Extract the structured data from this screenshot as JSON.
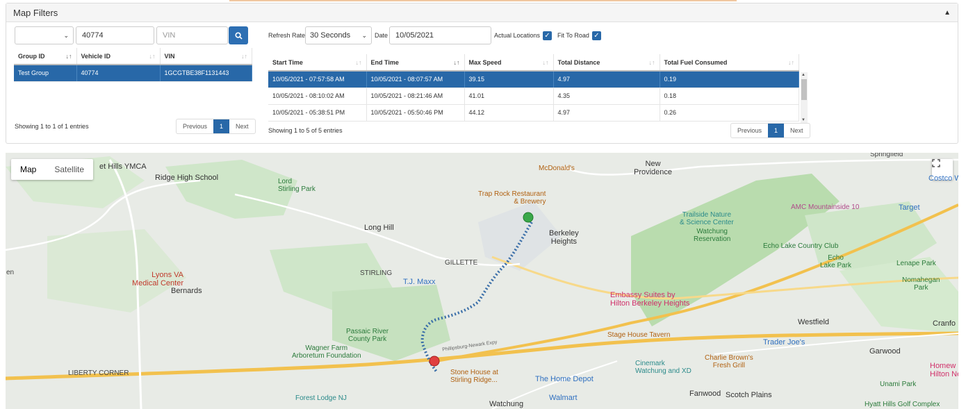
{
  "panel": {
    "title": "Map Filters"
  },
  "filters": {
    "group_select_value": "",
    "vehicle_id_value": "40774",
    "vin_placeholder": "VIN",
    "refresh_label": "Refresh Rate",
    "refresh_value": "30 Seconds",
    "date_label": "Date",
    "date_value": "10/05/2021",
    "actual_locations_label": "Actual Locations",
    "fit_to_road_label": "Fit To Road"
  },
  "vehicles_table": {
    "headers": [
      "Group ID",
      "Vehicle ID",
      "VIN"
    ],
    "rows": [
      [
        "Test Group",
        "40774",
        "1GCGTBE38F1131443"
      ]
    ],
    "showing": "Showing 1 to 1 of 1 entries",
    "pager": {
      "prev": "Previous",
      "page": "1",
      "next": "Next"
    }
  },
  "trips_table": {
    "headers": [
      "Start Time",
      "End Time",
      "Max Speed",
      "Total Distance",
      "Total Fuel Consumed"
    ],
    "rows": [
      [
        "10/05/2021 - 07:57:58 AM",
        "10/05/2021 - 08:07:57 AM",
        "39.15",
        "4.97",
        "0.19"
      ],
      [
        "10/05/2021 - 08:10:02 AM",
        "10/05/2021 - 08:21:46 AM",
        "41.01",
        "4.35",
        "0.18"
      ],
      [
        "10/05/2021 - 05:38:51 PM",
        "10/05/2021 - 05:50:46 PM",
        "44.12",
        "4.97",
        "0.26"
      ]
    ],
    "showing": "Showing 1 to 5 of 5 entries",
    "pager": {
      "prev": "Previous",
      "page": "1",
      "next": "Next"
    }
  },
  "map": {
    "type_map": "Map",
    "type_satellite": "Satellite",
    "labels": {
      "ymca": "et Hills YMCA",
      "ridge_high": "Ridge High School",
      "lord_stirling": "Lord\nStirling Park",
      "long_hill": "Long Hill",
      "stirling": "STIRLING",
      "gillette": "GILLETTE",
      "tjmaxx": "T.J. Maxx",
      "lyons": "Lyons VA\nMedical Center",
      "bernards": "Bernards",
      "passaic": "Passaic River\nCounty Park",
      "wagner": "Wagner Farm\nArboretum Foundation",
      "liberty_corner": "LIBERTY CORNER",
      "stone_house": "Stone House at\nStirling Ridge...",
      "forest_lodge": "Forest Lodge NJ",
      "watchung": "Watchung",
      "home_depot": "The Home Depot",
      "walmart": "Walmart",
      "mcdonalds": "McDonald's",
      "trap_rock": "Trap Rock Restaurant\n& Brewery",
      "berkeley_heights": "Berkeley\nHeights",
      "new_providence": "New\nProvidence",
      "embassy": "Embassy Suites by\nHilton Berkeley Heights",
      "stage_house": "Stage House Tavern",
      "cinemark": "Cinemark\nWatchung and XD",
      "trailside": "Trailside Nature\n& Science Center",
      "watchung_res": "Watchung\nReservation",
      "echo_lake_cc": "Echo Lake Country Club",
      "echo_lake_park": "Echo\nLake Park",
      "amc": "AMC Mountainside 10",
      "target": "Target",
      "lenape": "Lenape Park",
      "nomahegan": "Nomahegan\nPark",
      "westfield": "Westfield",
      "trader_joes": "Trader Joe's",
      "charlie_browns": "Charlie Brown's\nFresh Grill",
      "garwood": "Garwood",
      "fanwood": "Fanwood",
      "scotch_plains": "Scotch Plains",
      "unami": "Unami Park",
      "hyatt_hills": "Hyatt Hills Golf Complex",
      "springfield": "Springfield",
      "cranford": "Cranfo",
      "homewood": "Homew\nHilton Nev",
      "costco": "Costco Wh",
      "en": "en",
      "phillipsburg": "Phillipsburg-Newark Expy"
    }
  },
  "colors": {
    "primary": "#2868a8",
    "route": "#3a6ea8",
    "start": "#3aa84a",
    "end": "#e04040"
  }
}
